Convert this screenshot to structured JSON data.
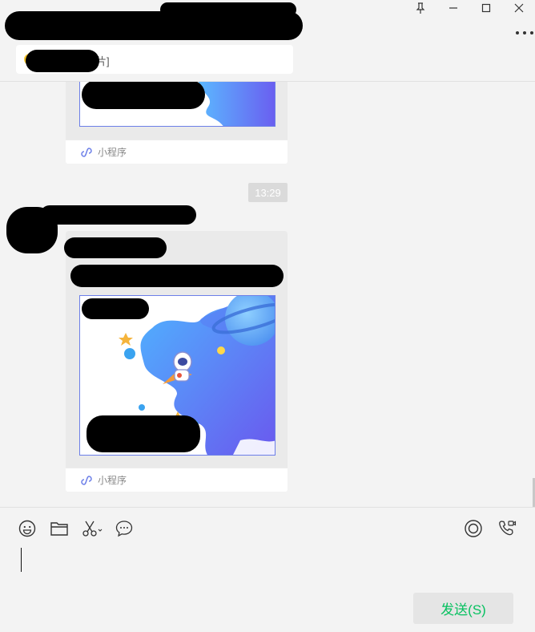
{
  "window": {
    "controls": [
      "pin-icon",
      "minimize-icon",
      "maximize-icon",
      "close-icon"
    ],
    "more_icon": "more-icon"
  },
  "pinned_notice": {
    "visible_text": "片]",
    "icon": "sun-emoji-icon"
  },
  "messages": [
    {
      "type": "mini-program-card",
      "footer_label": "小程序",
      "footer_icon": "mini-program-icon"
    },
    {
      "type": "timestamp",
      "text": "13:29"
    },
    {
      "type": "mini-program-card",
      "footer_label": "小程序",
      "footer_icon": "mini-program-icon"
    }
  ],
  "toolbar": {
    "icons": [
      "emoji-icon",
      "folder-icon",
      "scissors-icon",
      "chat-bubble-icon",
      "live-icon",
      "video-call-icon"
    ]
  },
  "composer": {
    "value": "",
    "send_label": "发送(S)"
  },
  "colors": {
    "background": "#f3f3f3",
    "send_text": "#07c160",
    "card_bg": "#eaeaea",
    "thumb_border": "#6c7fe8"
  }
}
